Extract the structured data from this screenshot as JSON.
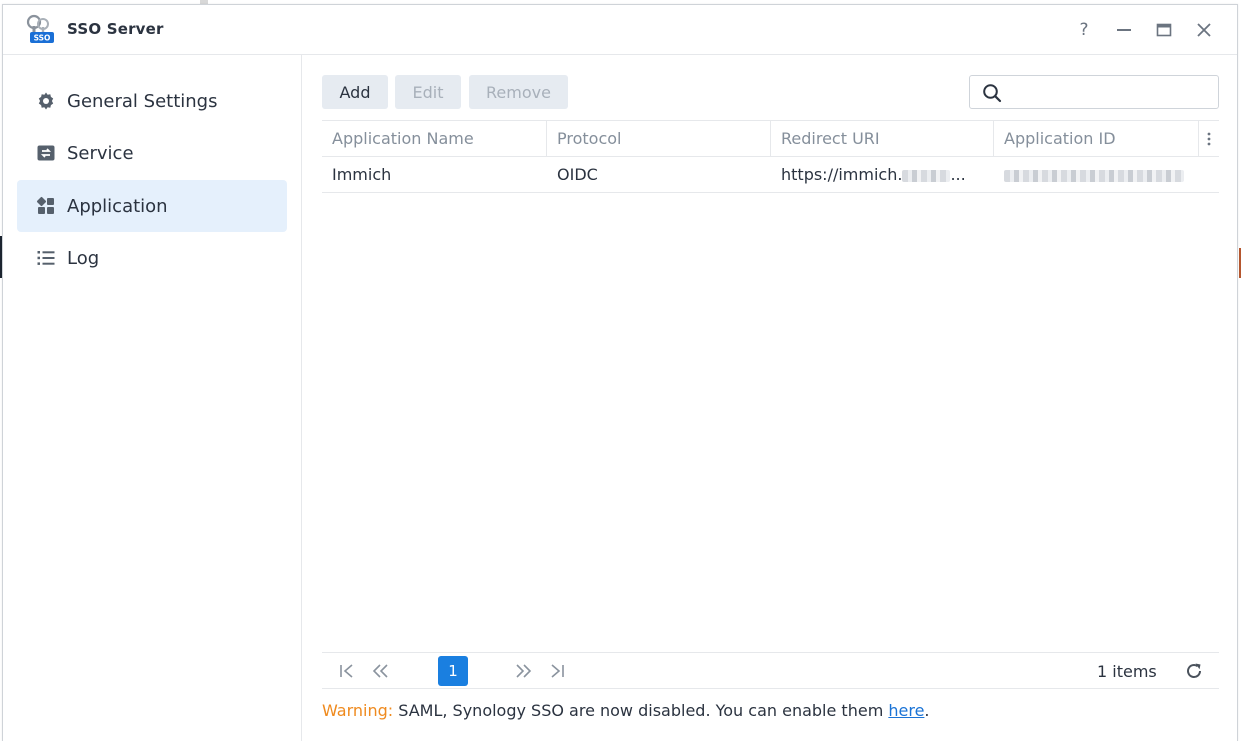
{
  "window": {
    "title": "SSO Server",
    "icon_badge": "SSO"
  },
  "titlebar": {
    "help_label": "?"
  },
  "sidebar": {
    "items": [
      {
        "label": "General Settings",
        "icon": "gear-icon"
      },
      {
        "label": "Service",
        "icon": "service-icon"
      },
      {
        "label": "Application",
        "icon": "apps-grid-icon",
        "active": true
      },
      {
        "label": "Log",
        "icon": "list-icon"
      }
    ]
  },
  "toolbar": {
    "add_label": "Add",
    "edit_label": "Edit",
    "remove_label": "Remove",
    "search_placeholder": ""
  },
  "table": {
    "columns": [
      "Application Name",
      "Protocol",
      "Redirect URI",
      "Application ID"
    ],
    "rows": [
      {
        "name": "Immich",
        "protocol": "OIDC",
        "redirect_uri_visible": "https://immich.",
        "redirect_uri_suffix": "..."
      }
    ]
  },
  "pager": {
    "current_page": "1",
    "items_text": "1 items"
  },
  "warning": {
    "label": "Warning:",
    "text": " SAML, Synology SSO are now disabled. You can enable them ",
    "link": "here",
    "end": "."
  },
  "colors": {
    "accent": "#1a7fe0",
    "active_nav_bg": "#e5f0fc",
    "warning": "#ef8a1e",
    "link": "#1a73d6"
  }
}
